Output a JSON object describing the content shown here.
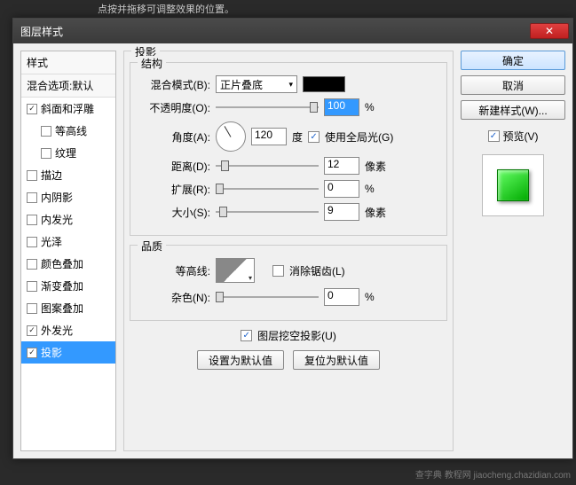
{
  "backdrop_hint": "点按并拖移可调整效果的位置。",
  "dialog_title": "图层样式",
  "sidebar": {
    "header1": "样式",
    "header2": "混合选项:默认",
    "items": [
      {
        "label": "斜面和浮雕",
        "checked": true,
        "indent": false
      },
      {
        "label": "等高线",
        "checked": false,
        "indent": true
      },
      {
        "label": "纹理",
        "checked": false,
        "indent": true
      },
      {
        "label": "描边",
        "checked": false,
        "indent": false
      },
      {
        "label": "内阴影",
        "checked": false,
        "indent": false
      },
      {
        "label": "内发光",
        "checked": false,
        "indent": false
      },
      {
        "label": "光泽",
        "checked": false,
        "indent": false
      },
      {
        "label": "颜色叠加",
        "checked": false,
        "indent": false
      },
      {
        "label": "渐变叠加",
        "checked": false,
        "indent": false
      },
      {
        "label": "图案叠加",
        "checked": false,
        "indent": false
      },
      {
        "label": "外发光",
        "checked": true,
        "indent": false
      },
      {
        "label": "投影",
        "checked": true,
        "indent": false,
        "selected": true
      }
    ]
  },
  "panel": {
    "title": "投影",
    "group_struct": "结构",
    "blend_mode_label": "混合模式(B):",
    "blend_mode_value": "正片叠底",
    "opacity_label": "不透明度(O):",
    "opacity_value": "100",
    "percent": "%",
    "angle_label": "角度(A):",
    "angle_value": "120",
    "angle_unit": "度",
    "global_light": "使用全局光(G)",
    "distance_label": "距离(D):",
    "distance_value": "12",
    "pixel": "像素",
    "spread_label": "扩展(R):",
    "spread_value": "0",
    "size_label": "大小(S):",
    "size_value": "9",
    "group_quality": "品质",
    "contour_label": "等高线:",
    "antialias": "消除锯齿(L)",
    "noise_label": "杂色(N):",
    "noise_value": "0",
    "knockout": "图层挖空投影(U)",
    "btn_default": "设置为默认值",
    "btn_reset": "复位为默认值"
  },
  "right": {
    "ok": "确定",
    "cancel": "取消",
    "new_style": "新建样式(W)...",
    "preview": "预览(V)"
  },
  "watermark": "查字典 教程网\njiaocheng.chazidian.com"
}
